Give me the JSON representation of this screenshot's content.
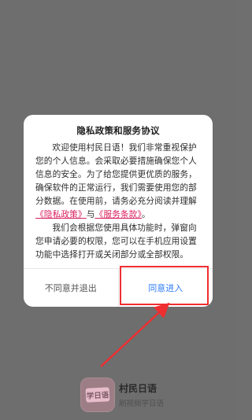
{
  "dialog": {
    "title": "隐私政策和服务协议",
    "paragraph1_part1": "欢迎使用村民日语！我们非常重视保护您的个人信息。会采取必要措施确保您个人信息的安全。为了给您提供更优质的服务，确保软件的正常运行，我们需要使用您的部分数据。在使用前，请务必充分阅读并理解",
    "privacy_link": "《隐私政策》",
    "and_text": "与",
    "terms_link": "《服务条款》",
    "period_text": "。",
    "paragraph2": "我们会根据您使用具体功能时，弹窗向您申请必要的权限，您可以在手机应用设置功能中选择打开或关闭部分或全部权限。",
    "disagree_button": "不同意并退出",
    "agree_button": "同意进入"
  },
  "app": {
    "icon_text": "学日语",
    "name": "村民日语",
    "subtitle": "刷视频学日语"
  },
  "colors": {
    "overlay": "#6e6e6e",
    "dialog_bg": "#ffffff",
    "link": "#d91e5b",
    "agree_button": "#2f7df6",
    "annotation_red": "#ef2e31"
  },
  "icons": {
    "annotation_arrow": "red-arrow"
  }
}
